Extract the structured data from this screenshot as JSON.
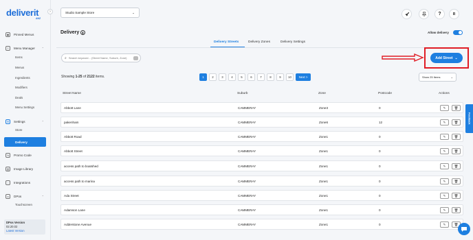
{
  "brand": {
    "name": "deliverit",
    "sub": "ANZ"
  },
  "sidebar": {
    "items": [
      {
        "label": "Pinned Menus"
      },
      {
        "label": "Menu Manager"
      },
      {
        "label": "Settings"
      },
      {
        "label": "Promo Code"
      },
      {
        "label": "Image Library"
      },
      {
        "label": "Integrations"
      },
      {
        "label": "DPos"
      }
    ],
    "menu_sub": [
      "Items",
      "Menus",
      "Ingredients",
      "Modifiers",
      "Deals",
      "Menu Settings"
    ],
    "settings_sub": [
      "Store",
      "Delivery"
    ],
    "dpos_sub": [
      "Touchscreen"
    ],
    "version": {
      "label": "DPos Version",
      "number": "02.20.02",
      "latest": "Latest Version"
    }
  },
  "header": {
    "store": "Studio Sample Store",
    "avatar": "R",
    "help": "?"
  },
  "page": {
    "title": "Delivery",
    "allow_label": "Allow delivery",
    "tabs": [
      "Delivery Streets",
      "Delivery Zones",
      "Delivery Settings"
    ],
    "search_placeholder": "Search keyword... (Street Name, Suburb, Zone)",
    "add_street": "Add Street",
    "showing_pre": "Showing ",
    "showing_range": "1-25",
    "showing_of": " of ",
    "showing_total": "2122",
    "showing_post": " items.",
    "pager": {
      "back": "< Back",
      "pages": [
        "1",
        "2",
        "3",
        "4",
        "5",
        "6",
        "7",
        "8",
        "9",
        "10"
      ],
      "next": "Next >"
    },
    "show_items": "Show 25 Items"
  },
  "table": {
    "headers": [
      "Street Name",
      "Suburb",
      "Zone",
      "Postcode",
      "Actions"
    ],
    "rows": [
      [
        "Abbott Lane",
        "CAMMERAY",
        "Zone3",
        "0"
      ],
      [
        "pakenham",
        "CAMMERAY",
        "Zone6",
        "12"
      ],
      [
        "Abbott Road",
        "CAMMERAY",
        "Zone1",
        "0"
      ],
      [
        "Abbott Street",
        "CAMMERAY",
        "Zone1",
        "0"
      ],
      [
        "access path to boatshed",
        "CAMMERAY",
        "Zone1",
        "0"
      ],
      [
        "access path to marina",
        "CAMMERAY",
        "Zone1",
        "0"
      ],
      [
        "Ada Street",
        "CAMMERAY",
        "Zone1",
        "0"
      ],
      [
        "Adamson Lane",
        "CAMMERAY",
        "Zone1",
        "0"
      ],
      [
        "Adderstone Avenue",
        "CAMMERAY",
        "Zone1",
        "0"
      ]
    ]
  },
  "feedback": "Feedback",
  "colors": {
    "accent": "#1e7fe0",
    "highlight": "#e01b24"
  }
}
